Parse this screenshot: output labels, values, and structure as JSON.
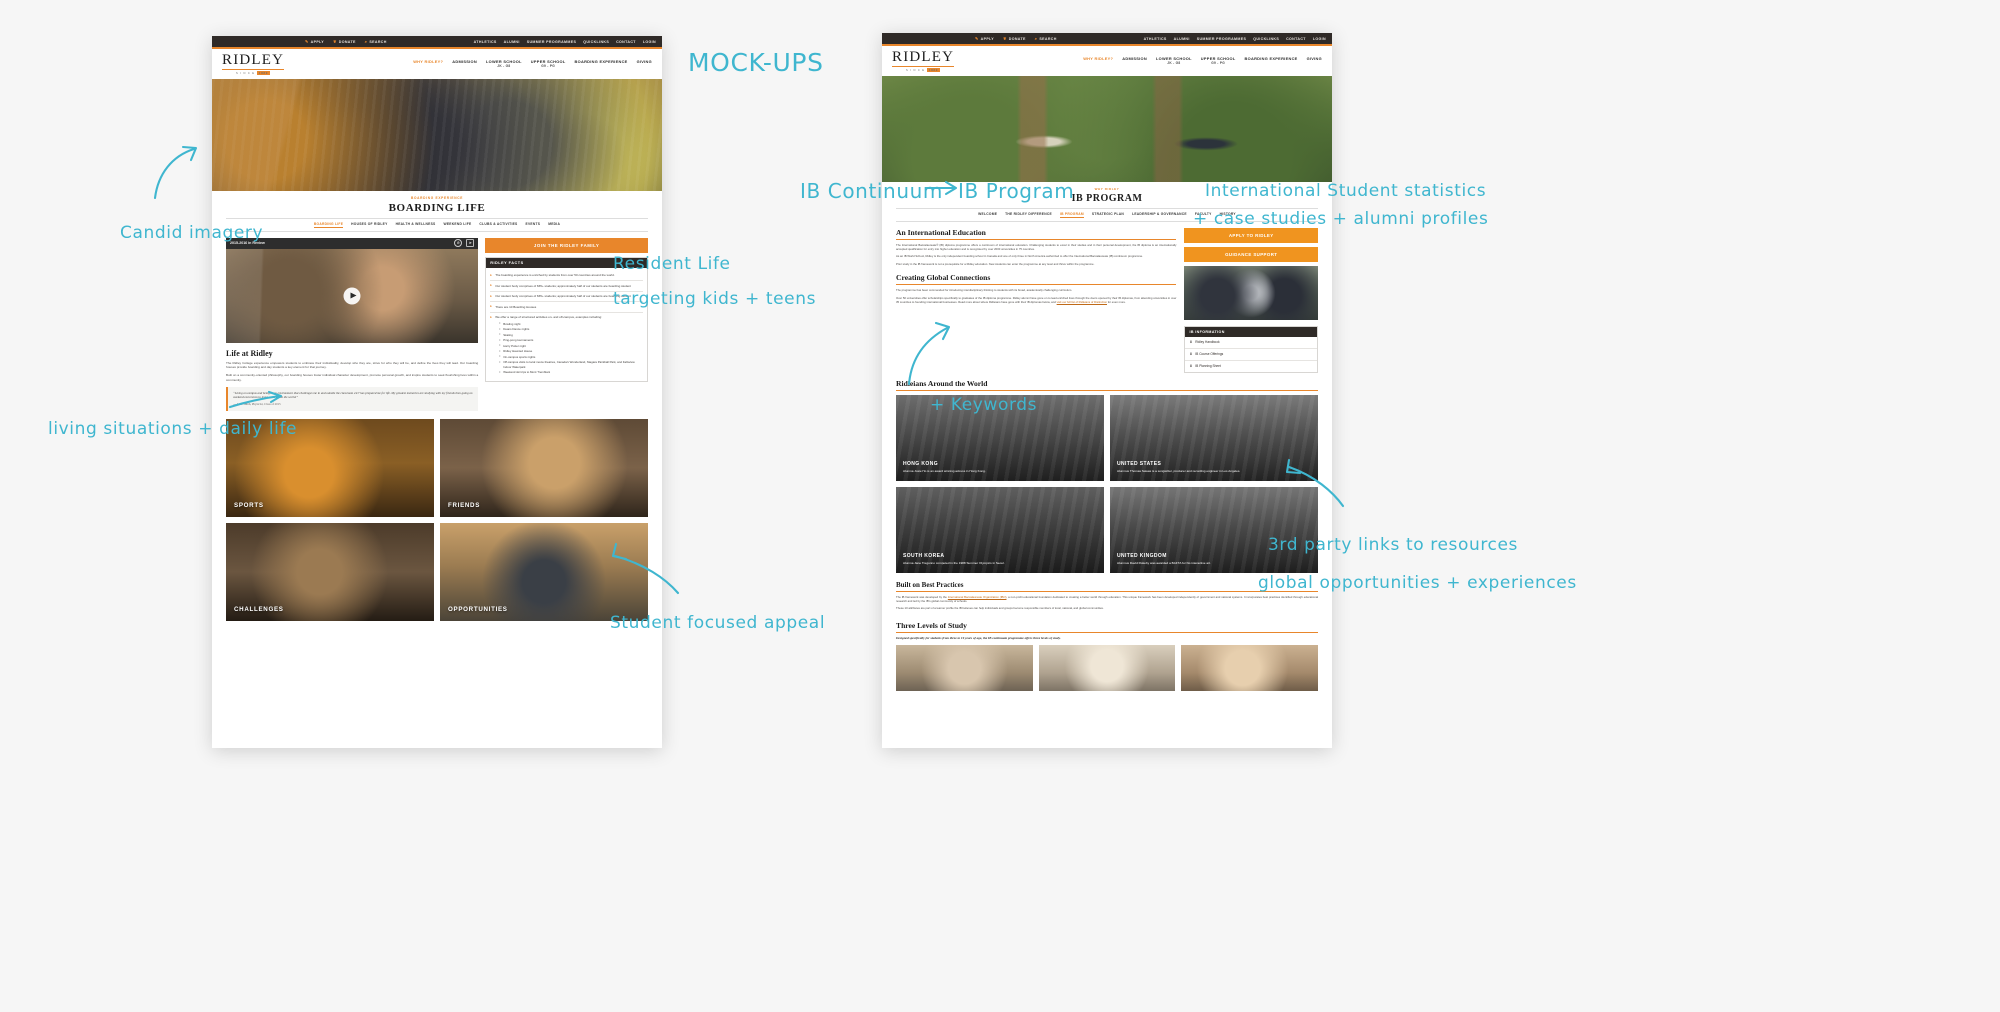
{
  "board": {
    "background": "#f6f6f6",
    "accent_teal": "#3fb6cf",
    "brand_orange": "#e8862b",
    "brand_dark": "#2f2a27"
  },
  "annotations": [
    {
      "id": "mockups",
      "text": "MOCK-UPS"
    },
    {
      "id": "candid",
      "text": "Candid imagery"
    },
    {
      "id": "resident",
      "text": "Resident Life"
    },
    {
      "id": "targeting",
      "text": "targeting kids + teens"
    },
    {
      "id": "living",
      "text": "living situations + daily life"
    },
    {
      "id": "student_appeal",
      "text": "Student focused appeal"
    },
    {
      "id": "ib_continuum",
      "text": "IB Continuum"
    },
    {
      "id": "ib_program",
      "text": "IB Program"
    },
    {
      "id": "intl_stats",
      "text": "International Student statistics"
    },
    {
      "id": "case_studies",
      "text": "+ case studies + alumni profiles"
    },
    {
      "id": "keywords",
      "text": "+ Keywords"
    },
    {
      "id": "third_party",
      "text": "3rd party links to resources"
    },
    {
      "id": "global_opps",
      "text": "global opportunities + experiences"
    }
  ],
  "topbar": {
    "left_items": [
      {
        "icon": "pencil-icon",
        "glyph": "✎",
        "label": "APPLY"
      },
      {
        "icon": "gift-icon",
        "glyph": "❦",
        "label": "DONATE"
      },
      {
        "icon": "search-icon",
        "glyph": "⌕",
        "label": "SEARCH"
      }
    ],
    "right_items": [
      "ATHLETICS",
      "ALUMNI",
      "SUMMER PROGRAMMES",
      "QUICKLINKS",
      "CONTACT",
      "LOGIN"
    ]
  },
  "logo": {
    "word": "RIDLEY",
    "since": "S I N C E",
    "year": "1889"
  },
  "mainnav_left": [
    {
      "label": "WHY RIDLEY?",
      "sub": "",
      "active": true
    },
    {
      "label": "ADMISSION",
      "sub": "",
      "active": false
    },
    {
      "label": "LOWER SCHOOL",
      "sub": "JK - G8",
      "active": false
    },
    {
      "label": "UPPER SCHOOL",
      "sub": "G9 - PG",
      "active": false
    },
    {
      "label": "BOARDING EXPERIENCE",
      "sub": "",
      "active": false
    },
    {
      "label": "GIVING",
      "sub": "",
      "active": false
    }
  ],
  "left_page": {
    "eyebrow": "BOARDING EXPERIENCE",
    "title": "BOARDING LIFE",
    "subnav": [
      {
        "label": "BOARDING LIFE",
        "active": true
      },
      {
        "label": "HOUSES OF RIDLEY",
        "active": false
      },
      {
        "label": "HEALTH & WELLNESS",
        "active": false
      },
      {
        "label": "WEEKEND LIFE",
        "active": false
      },
      {
        "label": "CLUBS & ACTIVITIES",
        "active": false
      },
      {
        "label": "EVENTS",
        "active": false
      },
      {
        "label": "MEDIA",
        "active": false
      }
    ],
    "video": {
      "title": "2015-2016 in Review",
      "play_label": "play-button"
    },
    "life": {
      "heading": "Life at Ridley",
      "p1": "The Ridley College experience empowers students to embrace their individuality, develop who they are, strive for who they will be, and define the lives they will lead. Our boarding houses provide boarding and day students a key element for that journey.",
      "p2": "Built on a community-oriented philosophy, our boarding houses foster individual character development, promote personal growth, and inspire students to seek flourishing lives within a community."
    },
    "quote": {
      "text": "“Living on campus and being in an environment that challenges me in and outside the classroom 24/7 has prepared me for life. My greatest memories are studying with my friends then going on weekend excursions to learn more about the world.”",
      "attribution": "— John Smith, Physicist, Class of 2015"
    },
    "cta_label": "JOIN THE RIDLEY FAMILY",
    "facts": {
      "heading": "RIDLEY FACTS",
      "items": [
        "The boarding experience is enriched by students from over 50 countries around the world.",
        "Our student body comprises of 665+ students; approximately half of our students are boarding student",
        "Our student body comprises of 665+ students; approximately half of our students are boarding student",
        "There are 10 Boarding Houses",
        "We offer a range of structured activities on- and off-campus, examples including:"
      ],
      "sub_items": [
        "Bowling night",
        "Deans Dance nights",
        "Skating",
        "Ping-pong tournaments",
        "Harry Potter night",
        "Ridley Haunted House",
        "On-campus sports nights",
        "Off-campus visits to local movie theatres, Canada’s Wonderland, Niagara Paintball Park, and Fallsview Indoor Waterpark",
        "Weekend ski trips to Mont Tremblant"
      ]
    },
    "tiles": [
      {
        "label": "SPORTS",
        "style": "t-sports"
      },
      {
        "label": "FRIENDS",
        "style": "t-friends"
      },
      {
        "label": "CHALLENGES",
        "style": "t-chal"
      },
      {
        "label": "OPPORTUNITIES",
        "style": "t-opp"
      }
    ]
  },
  "right_page": {
    "eyebrow": "WHY RIDLEY",
    "title": "IB PROGRAM",
    "subnav": [
      {
        "label": "WELCOME",
        "active": false
      },
      {
        "label": "THE RIDLEY DIFFERENCE",
        "active": false
      },
      {
        "label": "IB PROGRAM",
        "active": true
      },
      {
        "label": "STRATEGIC PLAN",
        "active": false
      },
      {
        "label": "LEADERSHIP & GOVERNANCE",
        "active": false
      },
      {
        "label": "FACULTY",
        "active": false
      },
      {
        "label": "HISTORY",
        "active": false
      }
    ],
    "intl": {
      "heading": "An International Education",
      "p1": "The International Baccalaureate® (IB) diploma programme offers a continuum of international education. Challenging students to excel in their studies and in their personal development, the IB diploma is an internationally accepted qualification for entry into higher education and is recognised by over 2000 universities in 75 countries.",
      "p2": "As an IB World School, Ridley is the only independent boarding school in Canada and one of only three in North America authorized to offer the International Baccalaureate (IB) continuum programme.",
      "p3": "Prior study in the IB framework is not a prerequisite for a Ridley education. New students can enter the programme at any level and thrive within the programme."
    },
    "global": {
      "heading": "Creating Global Connections",
      "p1": "The programme has been commended for introducing interdisciplinary thinking to students with its broad, academically challenging curriculum.",
      "p2_before": "Over 50 universities offer scholarships specifically to graduates of the IB diploma programme. Ridley alumni have gone on to lead enriched lives through the doors opened by their IB diplomas, from attending universities in over 35 countries to founding international businesses. Read more about where Ridleians have gone with their IB diplomas below, and ",
      "p2_link": "visit our full list of Ridleians of Distinction",
      "p2_after": " for even more."
    },
    "buttons": [
      {
        "label": "APPLY TO RIDLEY"
      },
      {
        "label": "GUIDANCE SUPPORT"
      }
    ],
    "infobox": {
      "heading": "IB INFORMATION",
      "items": [
        {
          "icon": "download-icon",
          "glyph": "⬇",
          "label": "Ridley Handbook"
        },
        {
          "icon": "download-icon",
          "glyph": "⬇",
          "label": "IB Course Offerings"
        },
        {
          "icon": "download-icon",
          "glyph": "⬇",
          "label": "IB Planning Sheet"
        }
      ]
    },
    "world": {
      "heading": "Ridleians Around the World",
      "cards": [
        {
          "country": "HONG KONG",
          "text": "Alumna Josie Ho is an award winning actress in Hong Kong.",
          "style": "w-hk"
        },
        {
          "country": "UNITED STATES",
          "text": "Alumnus Thomas Sawas is a songwriter, producer and recording engineer in Los Angeles.",
          "style": "w-us"
        },
        {
          "country": "SOUTH KOREA",
          "text": "Alumna Jane Tregunno competed in the 1988 Summer Olympics in Seoul.",
          "style": "w-kr"
        },
        {
          "country": "UNITED KINGDOM",
          "text": "Alumnus David Rokeby was awarded a BAFTA for his interactive art.",
          "style": "w-uk"
        }
      ]
    },
    "best_practices": {
      "heading": "Built on Best Practices",
      "p1_before": "The IB framework was developed by the ",
      "p1_link": "International Baccalaureate Organization (IBO)",
      "p1_after": ", a non-profit educational foundation dedicated to creating a better world through education. This unique framework has been developed independently of government and national systems. It incorporates best practices identified through educational research and led by the IB’s global community of schools.",
      "p2": "These 10 attributes are part of a learner profile the IB believes can help individuals and groups become responsible members of local, national, and global communities."
    },
    "three_levels": {
      "heading": "Three Levels of Study",
      "subtitle": "Designed specifically for students from three to 19 years of age, the IB continuum programme offers three levels of study."
    }
  }
}
